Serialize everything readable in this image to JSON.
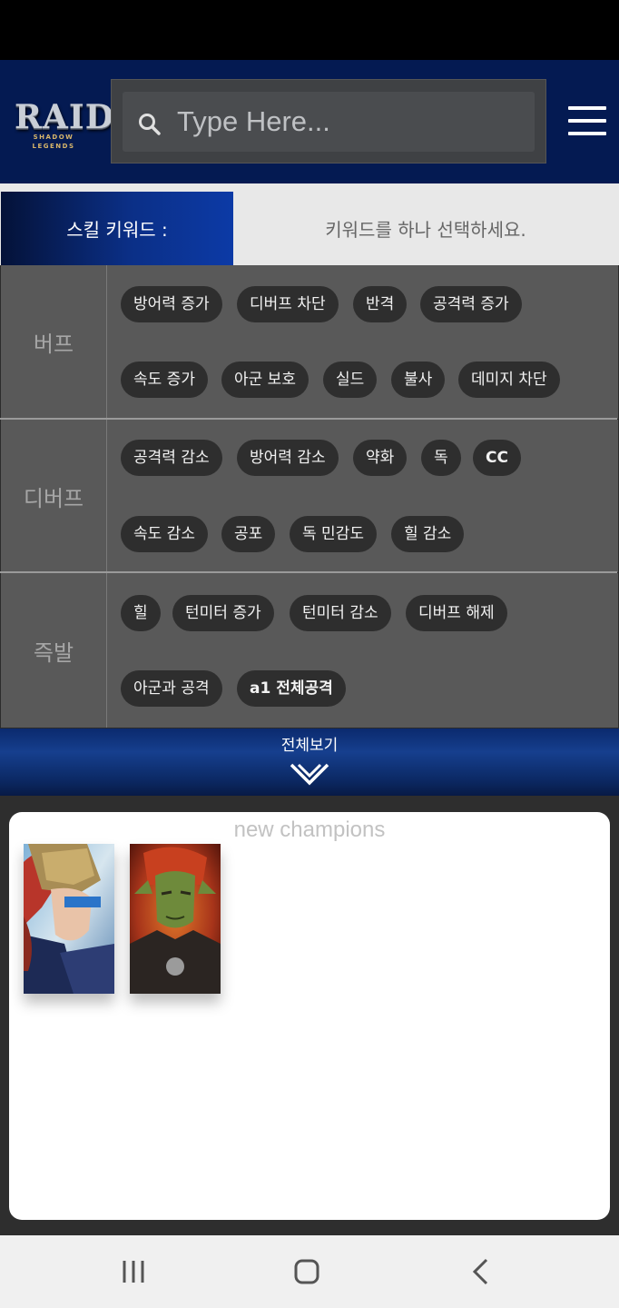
{
  "header": {
    "logo_title": "RAID",
    "logo_subtitle": "SHADOW LEGENDS",
    "search_placeholder": "Type Here..."
  },
  "skill_keyword": {
    "label": "스킬 키워드 :",
    "prompt": "키워드를 하나 선택하세요."
  },
  "categories": [
    {
      "name": "버프",
      "rows": [
        [
          "방어력 증가",
          "디버프 차단",
          "반격",
          "공격력 증가"
        ],
        [
          "속도 증가",
          "아군 보호",
          "실드",
          "불사",
          "데미지 차단"
        ]
      ]
    },
    {
      "name": "디버프",
      "rows": [
        [
          "공격력 감소",
          "방어력 감소",
          "약화",
          "독",
          "CC"
        ],
        [
          "속도 감소",
          "공포",
          "독 민감도",
          "힐 감소"
        ]
      ]
    },
    {
      "name": "즉발",
      "rows": [
        [
          "힐",
          "턴미터 증가",
          "턴미터 감소",
          "디버프 해제"
        ],
        [
          "아군과 공격",
          "a1 전체공격"
        ]
      ]
    }
  ],
  "expand": {
    "label": "전체보기",
    "icon": "double-chevron-down-icon"
  },
  "champions": {
    "title": "new champions",
    "items": [
      {
        "icon": "champion-portrait-helmeted-warrior"
      },
      {
        "icon": "champion-portrait-orc-warrior"
      }
    ]
  },
  "colors": {
    "header_bg": "#041a52",
    "chip_bg": "#2e2e2e",
    "panel_bg": "#595959",
    "accent_blue": "#0c3aa6"
  }
}
